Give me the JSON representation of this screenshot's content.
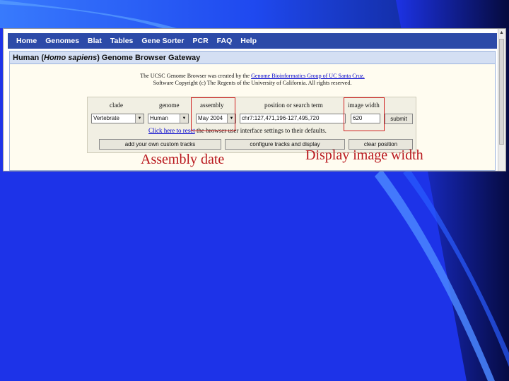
{
  "slide": {
    "background_color": "#1d33e8",
    "accent_color": "#3d7bff"
  },
  "browser": {
    "nav": [
      "Home",
      "Genomes",
      "Blat",
      "Tables",
      "Gene Sorter",
      "PCR",
      "FAQ",
      "Help"
    ],
    "nav_bar_color": "#2c4aa8",
    "title_prefix": "Human (",
    "title_species": "Homo sapiens",
    "title_suffix": ") Genome Browser Gateway",
    "credit_line1_a": "The UCSC Genome Browser was created by the ",
    "credit_link": "Genome Bioinformatics Group of UC Santa Cruz.",
    "credit_line2": "Software Copyright (c) The Regents of the University of California. All rights reserved.",
    "columns": {
      "clade": "clade",
      "genome": "genome",
      "assembly": "assembly",
      "position": "position or search term",
      "image_width": "image width"
    },
    "values": {
      "clade": "Vertebrate",
      "genome": "Human",
      "assembly": "May 2004",
      "position": "chr7:127,471,196-127,495,720",
      "image_width": "620"
    },
    "submit_label": "submit",
    "reset_link": "Click here to reset",
    "reset_text": " the browser user interface settings to their defaults.",
    "buttons": {
      "custom_tracks": "add your own custom tracks",
      "configure": "configure tracks and display",
      "clear": "clear position"
    }
  },
  "annotations": {
    "assembly_date": "Assembly date",
    "display_image_width": "Display image width",
    "highlight_color": "#d02020"
  }
}
